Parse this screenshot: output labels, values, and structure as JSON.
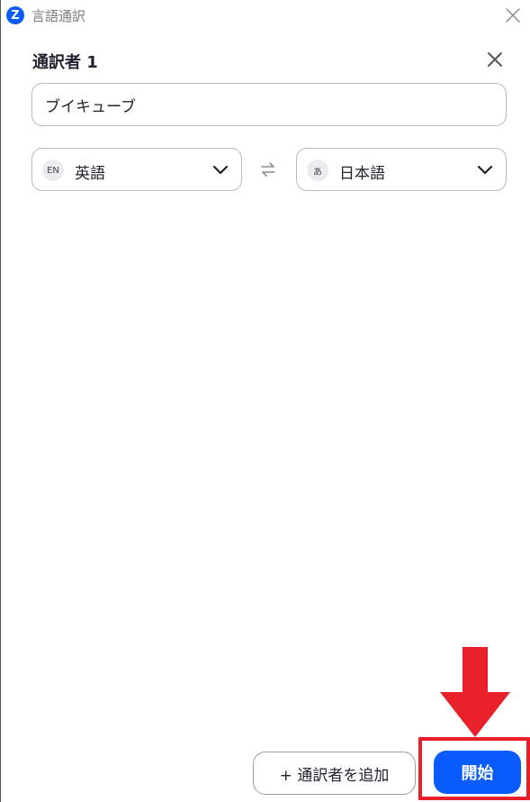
{
  "window": {
    "title": "言語通訳",
    "logo_letter": "Z",
    "close_icon": "close-icon"
  },
  "interpreter": {
    "heading": "通訳者 1",
    "name_value": "ブイキューブ",
    "remove_icon": "close-icon"
  },
  "languages": {
    "source": {
      "badge": "EN",
      "label": "英語"
    },
    "swap_icon": "swap-arrows-icon",
    "target": {
      "badge": "あ",
      "label": "日本語"
    }
  },
  "footer": {
    "add_label": "+ 通訳者を追加",
    "start_label": "開始"
  },
  "colors": {
    "accent": "#0b5cff",
    "annotation": "#e8202a"
  }
}
